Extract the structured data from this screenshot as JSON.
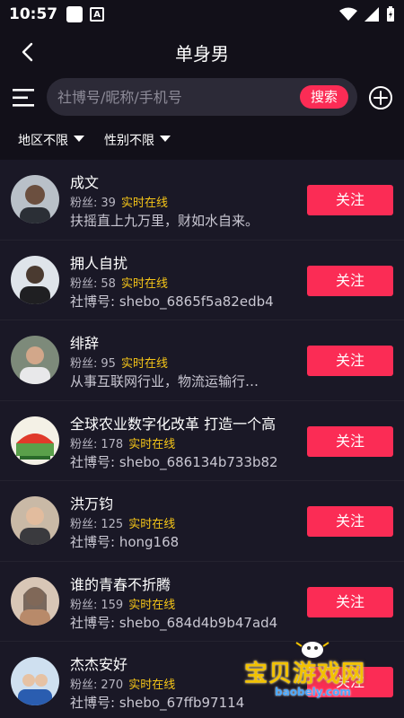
{
  "status_bar": {
    "time": "10:57",
    "a_label": "A"
  },
  "header": {
    "title": "单身男"
  },
  "search": {
    "placeholder": "社博号/昵称/手机号",
    "button_label": "搜索"
  },
  "filters": [
    {
      "label": "地区不限"
    },
    {
      "label": "性别不限"
    }
  ],
  "users": [
    {
      "name": "成文",
      "fans_label": "粉丝:",
      "fans": "39",
      "status": "实时在线",
      "subtitle": "扶摇直上九万里，财如水自来。",
      "follow_label": "关注",
      "avatar_bg": "#9aa3ad"
    },
    {
      "name": "拥人自扰",
      "fans_label": "粉丝:",
      "fans": "58",
      "status": "实时在线",
      "subtitle": "社博号: shebo_6865f5a82edb4",
      "follow_label": "关注",
      "avatar_bg": "#c7cdd4"
    },
    {
      "name": "绯辞",
      "fans_label": "粉丝:",
      "fans": "95",
      "status": "实时在线",
      "subtitle": "从事互联网行业，物流运输行…",
      "follow_label": "关注",
      "avatar_bg": "#8a9088"
    },
    {
      "name": "全球农业数字化改革  打造一个高",
      "fans_label": "粉丝:",
      "fans": "178",
      "status": "实时在线",
      "subtitle": "社博号: shebo_686134b733b82",
      "follow_label": "关注",
      "avatar_bg": "#6fa85a"
    },
    {
      "name": "洪万钧",
      "fans_label": "粉丝:",
      "fans": "125",
      "status": "实时在线",
      "subtitle": "社博号: hong168",
      "follow_label": "关注",
      "avatar_bg": "#b8a48e"
    },
    {
      "name": "谁的青春不折腾",
      "fans_label": "粉丝:",
      "fans": "159",
      "status": "实时在线",
      "subtitle": "社博号: shebo_684d4b9b47ad4",
      "follow_label": "关注",
      "avatar_bg": "#c9b3a2"
    },
    {
      "name": "杰杰安好",
      "fans_label": "粉丝:",
      "fans": "270",
      "status": "实时在线",
      "subtitle": "社博号: shebo_67ffb97114",
      "follow_label": "关注",
      "avatar_bg": "#a9c4e0"
    }
  ],
  "watermark": {
    "text": "宝贝游戏网",
    "url": "baobely.com"
  },
  "colors": {
    "accent": "#fb2c55",
    "online": "#f5c518",
    "background": "#1a1826"
  }
}
